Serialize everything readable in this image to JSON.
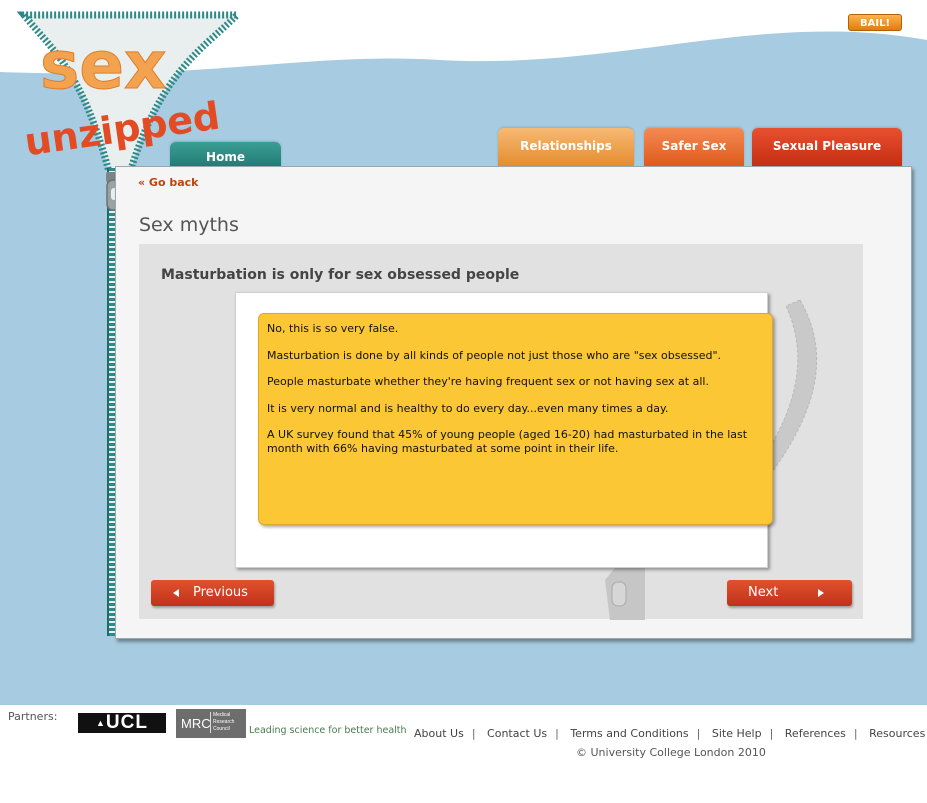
{
  "header": {
    "logo_top": "sex",
    "logo_bottom": "unzipped",
    "bail_label": "BAIL!"
  },
  "nav": {
    "home": "Home",
    "tabs": [
      "Relationships",
      "Safer Sex",
      "Sexual Pleasure"
    ]
  },
  "content": {
    "go_back": "« Go back",
    "page_title": "Sex myths",
    "question": "Masturbation is only for sex obsessed people",
    "answer": [
      "No, this is so very false.",
      "Masturbation is done by all kinds of people not just those who are \"sex obsessed\".",
      "People masturbate whether they're having frequent sex or not having sex at all.",
      "It is very normal and is healthy to do every day...even many times a day.",
      "A UK survey found that 45% of young people (aged 16-20) had masturbated in the last month with 66% having masturbated at some point in their life."
    ],
    "previous_label": "Previous",
    "next_label": "Next"
  },
  "footer": {
    "partners_label": "Partners:",
    "ucl": "UCL",
    "mrc": "MRC",
    "mrc_small": [
      "Medical",
      "Research",
      "Council"
    ],
    "mrc_tagline": "Leading science for better health",
    "links": [
      "About Us",
      "Contact Us",
      "Terms and Conditions",
      "Site Help",
      "References",
      "Resources"
    ],
    "copyright": "© University College London 2010"
  },
  "colors": {
    "sky": "#a7cbe0",
    "teal": "#2d8a86",
    "orange": "#e48d2f",
    "red": "#c62d12",
    "answer_yellow": "#fbc735"
  }
}
